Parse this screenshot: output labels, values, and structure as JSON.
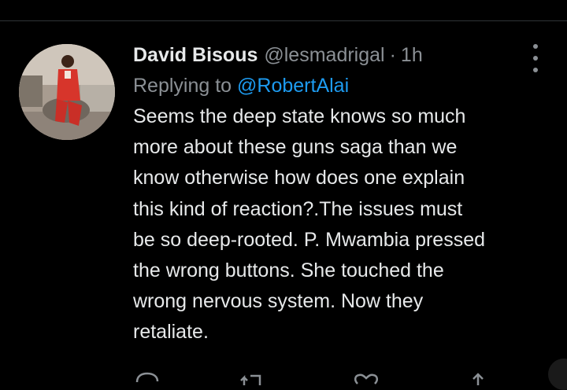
{
  "tweet": {
    "author_name": "David Bisous",
    "author_handle": "@lesmadrigal",
    "separator": "·",
    "time": "1h",
    "replying_prefix": "Replying to",
    "replying_handle": "@RobertAlai",
    "body_lines": [
      "Seems the deep state knows so much",
      "more about these guns saga than we",
      "know otherwise how does one explain",
      "this kind of reaction?.The issues must",
      "be so deep-rooted. P. Mwambia pressed",
      "the wrong buttons. She touched the",
      "wrong nervous system. Now they",
      "retaliate."
    ]
  },
  "icons": {
    "more": "more-vertical-icon",
    "reply": "reply-icon",
    "retweet": "retweet-icon",
    "like": "heart-icon",
    "share": "share-icon"
  },
  "colors": {
    "background": "#000000",
    "text": "#e7e9ea",
    "secondary": "#8b9095",
    "accent": "#1d9bf0"
  }
}
